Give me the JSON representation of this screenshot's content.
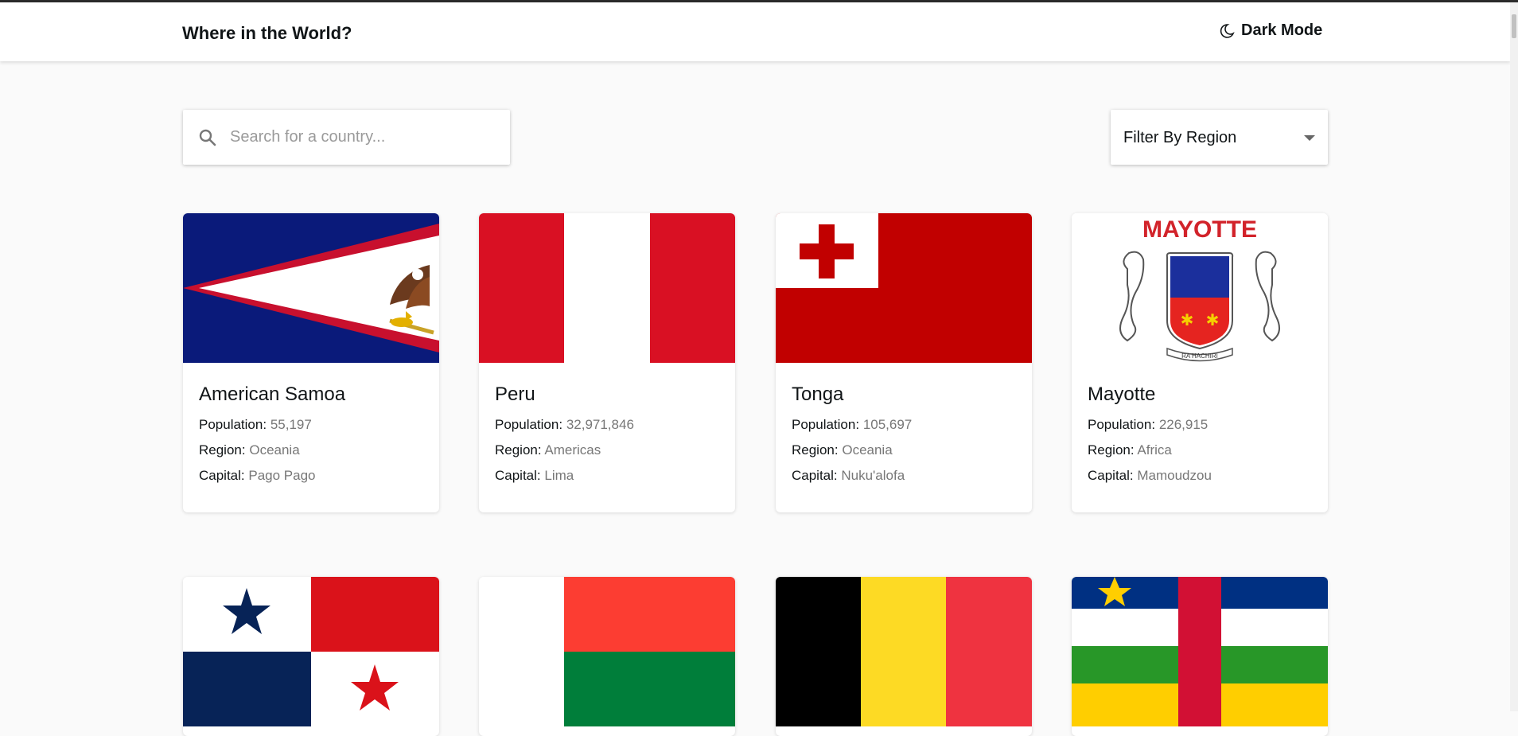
{
  "header": {
    "title": "Where in the World?",
    "dark_mode_label": "Dark Mode"
  },
  "search": {
    "placeholder": "Search for a country...",
    "value": ""
  },
  "filter": {
    "label": "Filter By Region"
  },
  "labels": {
    "population": "Population:",
    "region": "Region:",
    "capital": "Capital:"
  },
  "countries": [
    {
      "name": "American Samoa",
      "population": "55,197",
      "region": "Oceania",
      "capital": "Pago Pago"
    },
    {
      "name": "Peru",
      "population": "32,971,846",
      "region": "Americas",
      "capital": "Lima"
    },
    {
      "name": "Tonga",
      "population": "105,697",
      "region": "Oceania",
      "capital": "Nuku'alofa"
    },
    {
      "name": "Mayotte",
      "population": "226,915",
      "region": "Africa",
      "capital": "Mamoudzou",
      "flag_text": "MAYOTTE",
      "flag_motto": "RA HACHIRI"
    }
  ],
  "colors": {
    "background": "#fafafa",
    "text": "#111517",
    "muted": "#777777"
  }
}
